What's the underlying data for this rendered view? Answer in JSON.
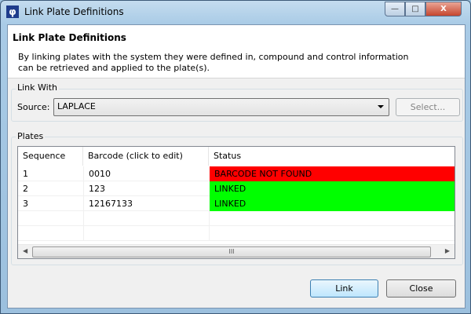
{
  "window": {
    "title": "Link Plate Definitions",
    "minimize": "—",
    "maximize": "□",
    "close": "X",
    "app_icon": "app-logo-icon"
  },
  "header": {
    "title": "Link Plate Definitions",
    "description": "By linking plates with the system they were defined in, compound and control information can be retrieved and applied to the plate(s)."
  },
  "link_with": {
    "group_label": "Link With",
    "source_label": "Source:",
    "source_value": "LAPLACE",
    "select_button": "Select..."
  },
  "plates": {
    "group_label": "Plates",
    "columns": [
      "Sequence",
      "Barcode (click to edit)",
      "Status"
    ],
    "rows": [
      {
        "sequence": "1",
        "barcode": "0010",
        "status": "BARCODE NOT FOUND",
        "status_color": "#ff0000"
      },
      {
        "sequence": "2",
        "barcode": "123",
        "status": "LINKED",
        "status_color": "#00ff00"
      },
      {
        "sequence": "3",
        "barcode": "12167133",
        "status": "LINKED",
        "status_color": "#00ff00"
      }
    ],
    "scroll_grip": "III"
  },
  "buttons": {
    "link": "Link",
    "close": "Close"
  }
}
